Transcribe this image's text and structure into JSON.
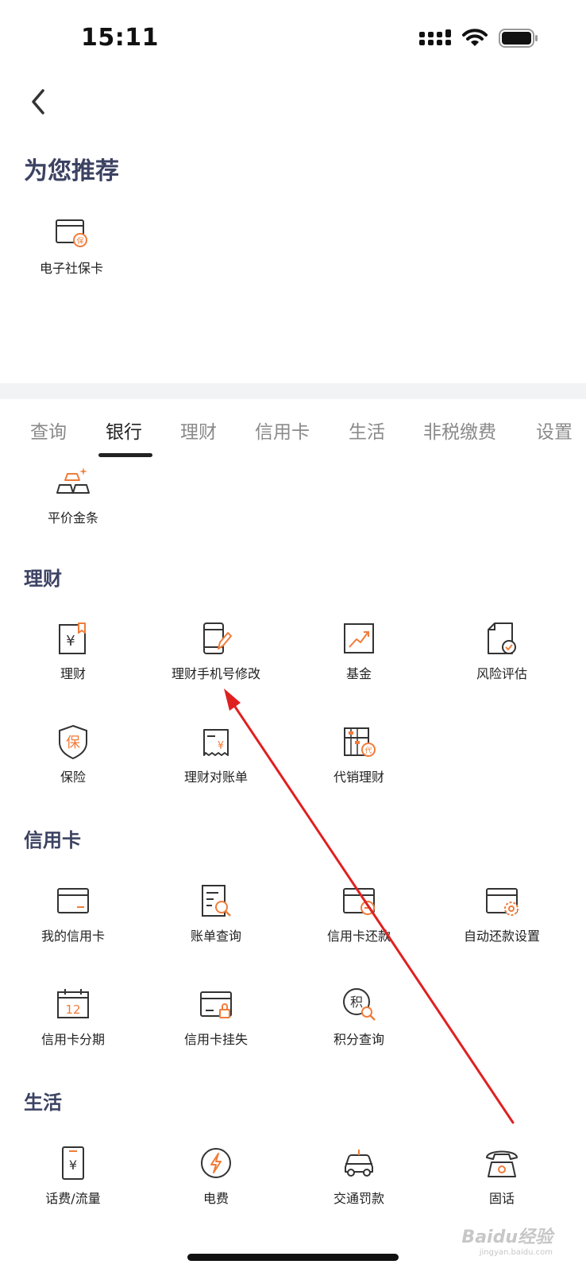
{
  "status_bar": {
    "time": "15:11"
  },
  "recommend": {
    "title": "为您推荐",
    "items": [
      {
        "label": "电子社保卡",
        "icon": "social-security-card-icon"
      }
    ]
  },
  "tabs": [
    "查询",
    "银行",
    "理财",
    "信用卡",
    "生活",
    "非税缴费",
    "设置"
  ],
  "active_tab": "银行",
  "bank_items": [
    {
      "label": "平价金条",
      "icon": "gold-bar-icon"
    }
  ],
  "sections": [
    {
      "title": "理财",
      "items": [
        {
          "label": "理财",
          "icon": "wealth-icon"
        },
        {
          "label": "理财手机号修改",
          "icon": "phone-edit-icon"
        },
        {
          "label": "基金",
          "icon": "fund-chart-icon"
        },
        {
          "label": "风险评估",
          "icon": "risk-assessment-icon"
        },
        {
          "label": "保险",
          "icon": "insurance-shield-icon"
        },
        {
          "label": "理财对账单",
          "icon": "statement-icon"
        },
        {
          "label": "代销理财",
          "icon": "abacus-icon"
        }
      ]
    },
    {
      "title": "信用卡",
      "items": [
        {
          "label": "我的信用卡",
          "icon": "credit-card-icon"
        },
        {
          "label": "账单查询",
          "icon": "bill-search-icon"
        },
        {
          "label": "信用卡还款",
          "icon": "card-repay-icon"
        },
        {
          "label": "自动还款设置",
          "icon": "card-settings-icon"
        },
        {
          "label": "信用卡分期",
          "icon": "calendar-12-icon"
        },
        {
          "label": "信用卡挂失",
          "icon": "card-lock-icon"
        },
        {
          "label": "积分查询",
          "icon": "points-search-icon"
        }
      ]
    },
    {
      "title": "生活",
      "items": [
        {
          "label": "话费/流量",
          "icon": "phone-bill-icon"
        },
        {
          "label": "电费",
          "icon": "electricity-icon"
        },
        {
          "label": "交通罚款",
          "icon": "car-icon"
        },
        {
          "label": "固话",
          "icon": "landline-phone-icon"
        }
      ]
    }
  ],
  "icon_text": {
    "bao": "保",
    "yuan": "¥",
    "dai": "代",
    "ji": "积",
    "twelve": "12"
  },
  "watermark": {
    "main": "Baidu经验",
    "sub": "jingyan.baidu.com"
  },
  "colors": {
    "accent": "#f07c3a",
    "title": "#3c4262",
    "text": "#222222",
    "annotation": "#e02020"
  }
}
